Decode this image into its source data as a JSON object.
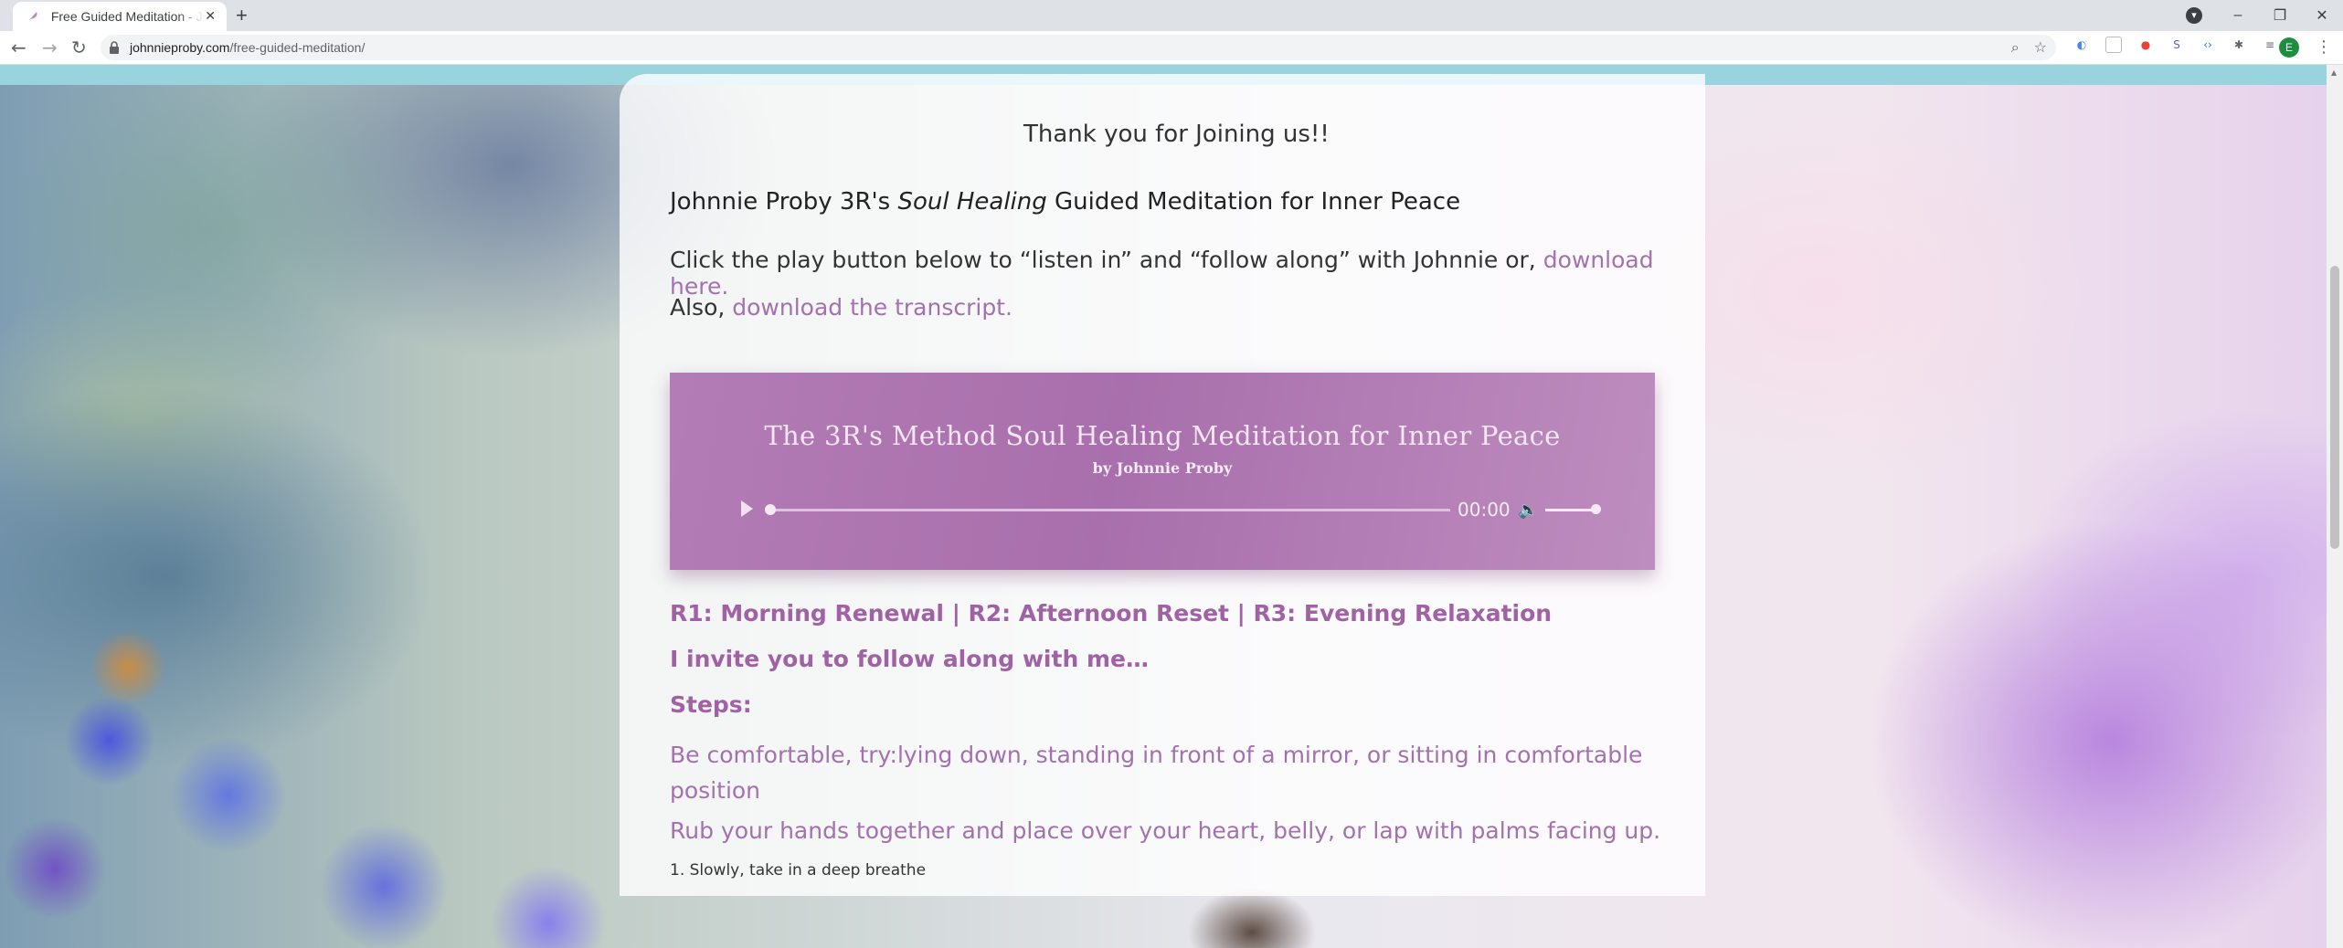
{
  "browser": {
    "tab_title": "Free Guided Meditation - Johnnie Proby",
    "tab_close": "✕",
    "new_tab": "+",
    "url_domain": "johnnieproby.com",
    "url_path": "/free-guided-meditation/",
    "avatar_letter": "E",
    "window_controls": {
      "minimize": "–",
      "restore": "❐",
      "close": "✕"
    }
  },
  "page": {
    "thanks": "Thank you for Joining us!!",
    "heading_prefix": "Johnnie Proby 3R's ",
    "heading_italic": "Soul Healing",
    "heading_suffix": " Guided Meditation for Inner Peace",
    "para1_text": "Click the play button below to “listen in” and “follow along” with Johnnie or, ",
    "para1_link": "download here.",
    "para2_text": "Also, ",
    "para2_link": "download the transcript.",
    "player": {
      "title": "The 3R's Method Soul Healing Meditation for Inner Peace",
      "by": "by Johnnie Proby",
      "time": "00:00",
      "progress": 0,
      "volume": 1.0
    },
    "line1": "R1: Morning Renewal | R2: Afternoon Reset | R3: Evening Relaxation",
    "line2": "I invite you to follow along with me…",
    "line3": "Steps:",
    "line4": "Be comfortable, try:lying down, standing in front of a mirror, or sitting in comfortable position",
    "line5": "Rub your hands together and place over your heart, belly, or lap with palms facing up.",
    "line6": "1. Slowly, take in a deep breathe"
  },
  "colors": {
    "link": "#a371ae",
    "player_bg": "#b47cb6",
    "topbar": "#98d3de"
  }
}
